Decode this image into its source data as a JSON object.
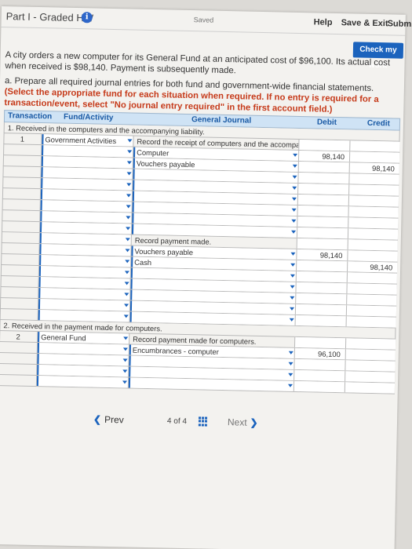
{
  "header": {
    "part_title": "Part I - Graded HW",
    "info_glyph": "i",
    "saved": "Saved",
    "help": "Help",
    "save_exit": "Save & Exit",
    "submit": "Submit"
  },
  "check_work": "Check my work",
  "question": "A city orders a new computer for its General Fund at an anticipated cost of $96,100. Its actual cost when received is $98,140. Payment is subsequently made.",
  "instruction_part": "a. Prepare all required journal entries for both fund and government-wide financial statements.",
  "instruction_red": "(Select the appropriate fund for each situation when required. If no entry is required for a transaction/event, select \"No journal entry required\" in the first account field.)",
  "journal": {
    "headers": {
      "transaction": "Transaction",
      "fund": "Fund/Activity",
      "title": "General Journal",
      "debit": "Debit",
      "credit": "Credit"
    },
    "caption1": "1. Received in the computers and the accompanying liability.",
    "caption2": "2. Received in the payment made for computers.",
    "rows1": [
      {
        "tx": "1",
        "fund": "Government Activities",
        "account": "Record the receipt of computers and the accompanying liability.",
        "debit": "",
        "credit": "",
        "note": true
      },
      {
        "tx": "",
        "fund": "",
        "account": "Computer",
        "debit": "98,140",
        "credit": ""
      },
      {
        "tx": "",
        "fund": "",
        "account": "Vouchers payable",
        "debit": "",
        "credit": "98,140"
      },
      {
        "tx": "",
        "fund": "",
        "account": "",
        "debit": "",
        "credit": ""
      },
      {
        "tx": "",
        "fund": "",
        "account": "",
        "debit": "",
        "credit": ""
      },
      {
        "tx": "",
        "fund": "",
        "account": "",
        "debit": "",
        "credit": ""
      },
      {
        "tx": "",
        "fund": "",
        "account": "",
        "debit": "",
        "credit": ""
      },
      {
        "tx": "",
        "fund": "",
        "account": "",
        "debit": "",
        "credit": ""
      },
      {
        "tx": "",
        "fund": "",
        "account": "",
        "debit": "",
        "credit": ""
      },
      {
        "tx": "",
        "fund": "",
        "account": "Record payment made.",
        "debit": "",
        "credit": "",
        "note": true
      },
      {
        "tx": "",
        "fund": "",
        "account": "Vouchers payable",
        "debit": "98,140",
        "credit": ""
      },
      {
        "tx": "",
        "fund": "",
        "account": "Cash",
        "debit": "",
        "credit": "98,140"
      },
      {
        "tx": "",
        "fund": "",
        "account": "",
        "debit": "",
        "credit": ""
      },
      {
        "tx": "",
        "fund": "",
        "account": "",
        "debit": "",
        "credit": ""
      },
      {
        "tx": "",
        "fund": "",
        "account": "",
        "debit": "",
        "credit": ""
      },
      {
        "tx": "",
        "fund": "",
        "account": "",
        "debit": "",
        "credit": ""
      },
      {
        "tx": "",
        "fund": "",
        "account": "",
        "debit": "",
        "credit": ""
      }
    ],
    "rows2": [
      {
        "tx": "2",
        "fund": "General Fund",
        "account": "Record payment made for computers.",
        "debit": "",
        "credit": "",
        "note": true
      },
      {
        "tx": "",
        "fund": "",
        "account": "Encumbrances - computer",
        "debit": "96,100",
        "credit": ""
      },
      {
        "tx": "",
        "fund": "",
        "account": "",
        "debit": "",
        "credit": ""
      },
      {
        "tx": "",
        "fund": "",
        "account": "",
        "debit": "",
        "credit": ""
      },
      {
        "tx": "",
        "fund": "",
        "account": "",
        "debit": "",
        "credit": ""
      }
    ]
  },
  "footer": {
    "prev": "Prev",
    "page_current": "4",
    "page_of": "of",
    "page_total": "4",
    "next": "Next"
  },
  "colors": {
    "accent": "#1b63bd",
    "instruction_red": "#c63b1b",
    "header_bg": "#cfe3f5"
  }
}
